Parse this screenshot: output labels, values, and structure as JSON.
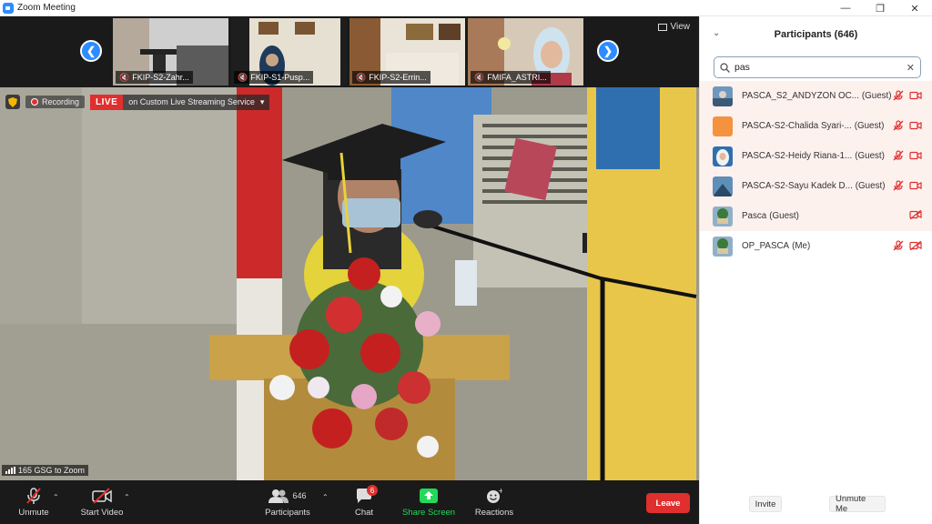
{
  "window": {
    "title": "Zoom Meeting",
    "controls": {
      "minimize": "—",
      "restore": "❐",
      "close": "✕"
    }
  },
  "thumbnails": [
    {
      "name": "FKIP-S2-Zahr..."
    },
    {
      "name": "FKIP-S1-Pusp..."
    },
    {
      "name": "FKIP-S2-Errin..."
    },
    {
      "name": "FMIFA_ASTRI..."
    }
  ],
  "view": {
    "label": "View"
  },
  "recording": {
    "label": "Recording",
    "live": "LIVE",
    "stream": "on Custom Live Streaming Service"
  },
  "signal": {
    "label": "165 GSG to Zoom"
  },
  "toolbar": {
    "unmute": "Unmute",
    "start_video": "Start Video",
    "participants": "Participants",
    "participants_count": "646",
    "chat": "Chat",
    "chat_badge": "6",
    "share_screen": "Share Screen",
    "reactions": "Reactions",
    "leave": "Leave"
  },
  "panel": {
    "title": "Participants (646)",
    "search_value": "pas",
    "participants": [
      {
        "name": "PASCA_S2_ANDYZON OC...",
        "role": "(Guest)",
        "avatar": "photo-blue"
      },
      {
        "name": "PASCA-S2-Chalida Syari-...",
        "role": "(Guest)",
        "avatar": "orange"
      },
      {
        "name": "PASCA-S2-Heidy Riana-1...",
        "role": "(Guest)",
        "avatar": "photo-hijab"
      },
      {
        "name": "PASCA-S2-Sayu Kadek D...",
        "role": "(Guest)",
        "avatar": "photo-blue"
      },
      {
        "name": "Pasca",
        "role": "(Guest)",
        "avatar": "photo-tree"
      },
      {
        "name": "OP_PASCA",
        "role": "(Me)",
        "avatar": "photo-tree"
      }
    ],
    "invite": "Invite",
    "unmute_me": "Unmute Me"
  },
  "colors": {
    "accent": "#2d8cff",
    "danger": "#e02f2f",
    "share": "#23d959",
    "toolbar_bg": "#1a1a1a"
  }
}
